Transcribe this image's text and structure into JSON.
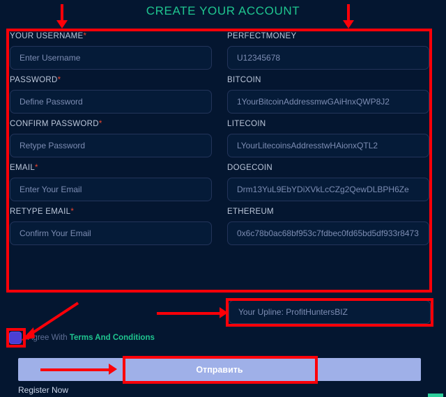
{
  "page": {
    "title": "CREATE YOUR ACCOUNT",
    "background_color": "#041630",
    "accent_color": "#1fc58f",
    "annotation_color": "#fd0008"
  },
  "form": {
    "rows": [
      {
        "left": {
          "label": "YOUR USERNAME",
          "required": true,
          "placeholder": "Enter Username",
          "value": ""
        },
        "right": {
          "label": "PERFECTMONEY",
          "required": false,
          "placeholder": "U12345678",
          "value": ""
        }
      },
      {
        "left": {
          "label": "PASSWORD",
          "required": true,
          "placeholder": "Define Password",
          "value": ""
        },
        "right": {
          "label": "BITCOIN",
          "required": false,
          "placeholder": "1YourBitcoinAddressmwGAiHnxQWP8J2",
          "value": ""
        }
      },
      {
        "left": {
          "label": "CONFIRM PASSWORD",
          "required": true,
          "placeholder": "Retype Password",
          "value": ""
        },
        "right": {
          "label": "LITECOIN",
          "required": false,
          "placeholder": "LYourLitecoinsAddresstwHAionxQTL2",
          "value": ""
        }
      },
      {
        "left": {
          "label": "EMAIL",
          "required": true,
          "placeholder": "Enter Your Email",
          "value": ""
        },
        "right": {
          "label": "DOGECOIN",
          "required": false,
          "placeholder": "Drm13YuL9EbYDiXVkLcCZg2QewDLBPH6Ze",
          "value": ""
        }
      },
      {
        "left": {
          "label": "RETYPE EMAIL",
          "required": true,
          "placeholder": "Confirm Your Email",
          "value": ""
        },
        "right": {
          "label": "ETHEREUM",
          "required": false,
          "placeholder": "0x6c78b0ac68bf953c7fdbec0fd65bd5df933r8473",
          "value": ""
        }
      }
    ],
    "upline": {
      "placeholder": "Your Upline: ProfitHuntersBIZ",
      "value": ""
    },
    "terms": {
      "checked": true,
      "prefix_text": "I Agree With ",
      "link_text": "Terms And Conditions"
    },
    "submit_label": "Отправить",
    "register_now_label": "Register Now"
  },
  "annotations": {
    "form_box_label": "form-fields-highlight",
    "upline_box_label": "upline-field-highlight",
    "checkbox_box_label": "terms-checkbox-highlight",
    "submit_box_label": "submit-button-highlight",
    "arrow_count": 5
  }
}
